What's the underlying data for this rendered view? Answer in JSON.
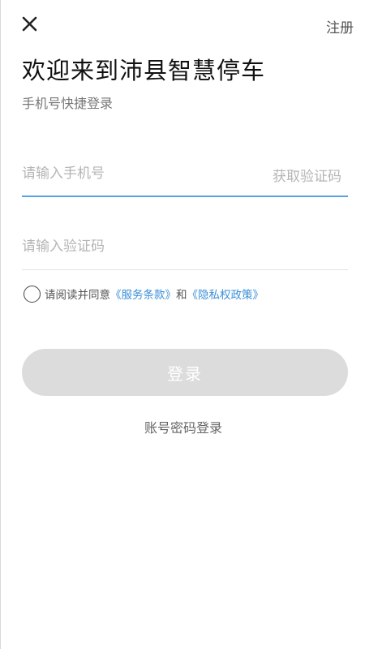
{
  "header": {
    "close_icon": "close-icon",
    "register_label": "注册"
  },
  "welcome": {
    "title": "欢迎来到沛县智慧停车",
    "subtitle": "手机号快捷登录"
  },
  "form": {
    "phone_placeholder": "请输入手机号",
    "phone_value": "",
    "get_code_label": "获取验证码",
    "code_placeholder": "请输入验证码",
    "code_value": ""
  },
  "agreement": {
    "checked": false,
    "prefix": "请阅读并同意",
    "terms_link": "《服务条款》",
    "connector": "和",
    "privacy_link": "《隐私权政策》"
  },
  "actions": {
    "login_label": "登录",
    "password_login_label": "账号密码登录"
  },
  "colors": {
    "accent": "#5aa0e6",
    "link": "#3a8fd8",
    "button_disabled": "#dcdcdc"
  }
}
